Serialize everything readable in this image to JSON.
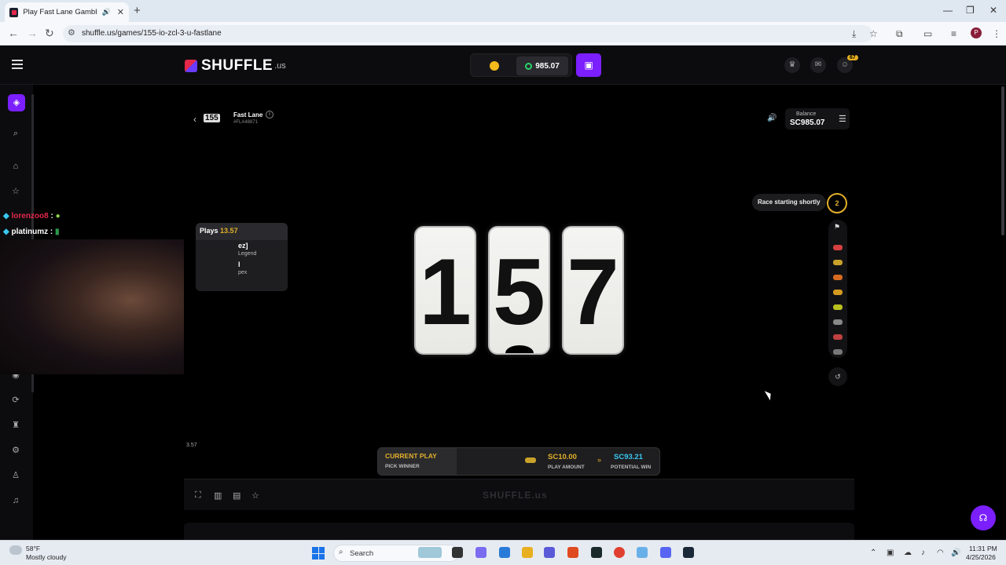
{
  "browser": {
    "tab_title": "Play Fast Lane Gambling Ga",
    "tab_audio_icon": "speaker-icon",
    "url": "shuffle.us/games/155-io-zcl-3-u-fastlane",
    "new_tab_label": "+",
    "profile_initial": "P"
  },
  "header": {
    "logo_text": "SHUFFLE",
    "logo_tld": ".us",
    "balance": "985.07",
    "notification_count": "67"
  },
  "chat": {
    "lines": [
      {
        "user": "lorenzoo8",
        "suffix": " :",
        "color": "#e3284a"
      },
      {
        "user": "platinumz",
        "suffix": " :",
        "color": "#ffffff"
      }
    ]
  },
  "game": {
    "logo": "155",
    "name": "Fast Lane",
    "id": "#FLA48871",
    "balance_label": "Balance",
    "balance_value": "SC985.07",
    "race_status": "Race starting shortly",
    "race_count": "2",
    "countdown_digits": [
      "1",
      "5",
      "7"
    ],
    "plays_label": "Plays",
    "plays_value": "13.57",
    "plays_rows": [
      "ez]",
      "Legend",
      "l",
      "pex"
    ],
    "side_value": "3.57",
    "racers": [
      {
        "color": "#d64040"
      },
      {
        "color": "#c8a22a"
      },
      {
        "color": "#d66a20"
      },
      {
        "color": "#d69a20"
      },
      {
        "color": "#b8c020"
      },
      {
        "color": "#888888"
      },
      {
        "color": "#c04040"
      },
      {
        "color": "#777777"
      }
    ],
    "current_play": {
      "title": "CURRENT PLAY",
      "subtitle": "PICK WINNER",
      "amount": "SC10.00",
      "amount_label": "PLAY AMOUNT",
      "win": "SC93.21",
      "win_label": "POTENTIAL WIN"
    },
    "footer_watermark": "SHUFFLE.us"
  },
  "taskbar": {
    "temp": "58°F",
    "weather": "Mostly cloudy",
    "search_placeholder": "Search",
    "time": "11:31 PM",
    "date": "4/25/2026"
  },
  "colors": {
    "accent": "#7b1fff",
    "gold": "#e3b02a",
    "win_blue": "#39c7f0",
    "brand_red": "#e3284a"
  }
}
